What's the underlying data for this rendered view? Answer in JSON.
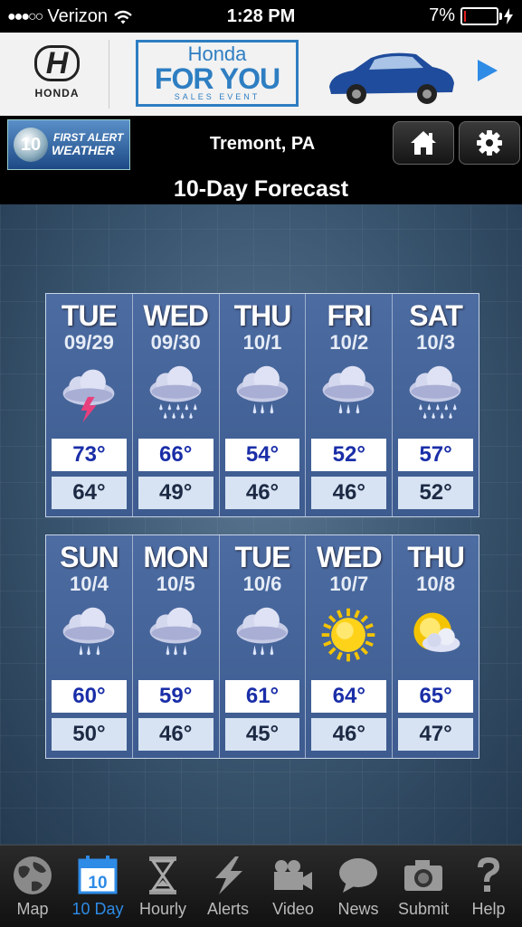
{
  "status_bar": {
    "signal": "●●●○○",
    "carrier": "Verizon",
    "time": "1:28 PM",
    "battery_text": "7%",
    "battery_level": 0.07
  },
  "ad": {
    "brand_name": "HONDA",
    "campaign_line1": "Honda",
    "campaign_line2": "FOR YOU",
    "campaign_line3": "SALES EVENT"
  },
  "header": {
    "logo_number": "10",
    "logo_line1": "FIRST ALERT",
    "logo_line2": "WEATHER",
    "location": "Tremont, PA",
    "title": "10-Day Forecast"
  },
  "forecast": [
    {
      "day": "TUE",
      "date": "09/29",
      "icon": "thunderstorm",
      "high": "73°",
      "low": "64°"
    },
    {
      "day": "WED",
      "date": "09/30",
      "icon": "heavy-rain",
      "high": "66°",
      "low": "49°"
    },
    {
      "day": "THU",
      "date": "10/1",
      "icon": "rain",
      "high": "54°",
      "low": "46°"
    },
    {
      "day": "FRI",
      "date": "10/2",
      "icon": "rain",
      "high": "52°",
      "low": "46°"
    },
    {
      "day": "SAT",
      "date": "10/3",
      "icon": "heavy-rain",
      "high": "57°",
      "low": "52°"
    },
    {
      "day": "SUN",
      "date": "10/4",
      "icon": "rain",
      "high": "60°",
      "low": "50°"
    },
    {
      "day": "MON",
      "date": "10/5",
      "icon": "rain",
      "high": "59°",
      "low": "46°"
    },
    {
      "day": "TUE",
      "date": "10/6",
      "icon": "rain",
      "high": "61°",
      "low": "45°"
    },
    {
      "day": "WED",
      "date": "10/7",
      "icon": "sunny",
      "high": "64°",
      "low": "46°"
    },
    {
      "day": "THU",
      "date": "10/8",
      "icon": "partly-cloudy",
      "high": "65°",
      "low": "47°"
    }
  ],
  "tabs": [
    {
      "label": "Map",
      "icon": "globe-icon",
      "active": false
    },
    {
      "label": "10 Day",
      "icon": "calendar-icon",
      "active": true,
      "icon_text": "10"
    },
    {
      "label": "Hourly",
      "icon": "hourglass-icon",
      "active": false
    },
    {
      "label": "Alerts",
      "icon": "lightning-icon",
      "active": false
    },
    {
      "label": "Video",
      "icon": "video-camera-icon",
      "active": false
    },
    {
      "label": "News",
      "icon": "speech-bubble-icon",
      "active": false
    },
    {
      "label": "Submit",
      "icon": "camera-icon",
      "active": false
    },
    {
      "label": "Help",
      "icon": "question-icon",
      "active": false
    }
  ],
  "colors": {
    "accent": "#2e8be6",
    "high_text": "#1a2ea8",
    "battery_low": "#e02020"
  }
}
